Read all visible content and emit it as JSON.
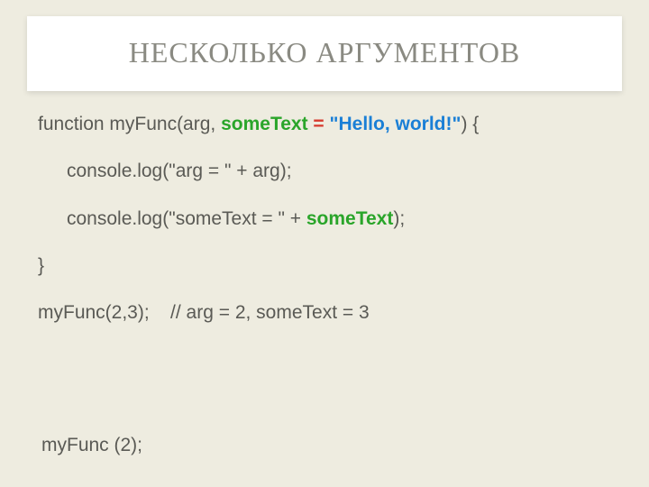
{
  "title": "НЕСКОЛЬКО АРГУМЕНТОВ",
  "code": {
    "fn_open_1": "function myFunc(arg, ",
    "param_name": "someText",
    "param_eq": " = ",
    "param_val": "\"Hello, world!\"",
    "fn_open_2": ") {",
    "log1": "console.log(\"arg = \" + arg);",
    "log2_a": "console.log(\"someText = \" + ",
    "log2_b": "someText",
    "log2_c": ");",
    "close": "}",
    "call1": "myFunc(2,3);    // arg = 2, someText = 3",
    "call2": "myFunc (2);"
  }
}
